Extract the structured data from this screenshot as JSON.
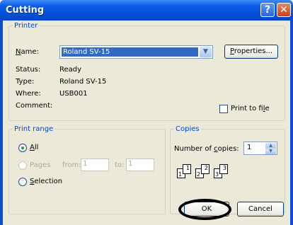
{
  "window": {
    "title": "Cutting",
    "help_glyph": "?",
    "close_glyph": "✕"
  },
  "printer": {
    "legend": "Printer",
    "name_label": "Name:",
    "name_value": "Roland SV-15",
    "properties_label": "Properties...",
    "status_label": "Status:",
    "status_value": "Ready",
    "type_label": "Type:",
    "type_value": "Roland SV-15",
    "where_label": "Where:",
    "where_value": "USB001",
    "comment_label": "Comment:",
    "print_to_file_label": "Print to file",
    "print_to_file_checked": false
  },
  "print_range": {
    "legend": "Print range",
    "all_label": "All",
    "pages_label": "Pages",
    "from_label": "from:",
    "from_value": "1",
    "to_label": "to:",
    "to_value": "1",
    "selection_label": "Selection",
    "selected": "all"
  },
  "copies": {
    "legend": "Copies",
    "number_label": "Number of copies:",
    "number_value": "1",
    "collate_pages": [
      "1",
      "1",
      "2",
      "2",
      "3",
      "3"
    ]
  },
  "buttons": {
    "ok_label": "OK",
    "cancel_label": "Cancel"
  },
  "colors": {
    "title_bar": "#0450d8",
    "legend_text": "#0046d5",
    "dialog_bg": "#ece9d8",
    "selection": "#316ac5"
  }
}
